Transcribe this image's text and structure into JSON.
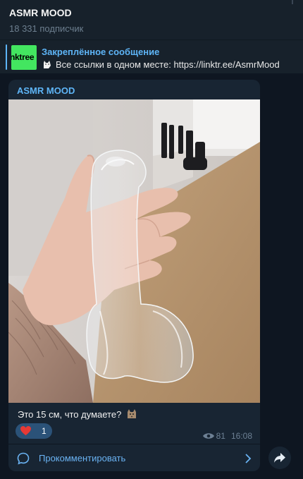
{
  "channel": {
    "title": "ASMR MOOD",
    "subscribers": "18 331 подписчик"
  },
  "pinned": {
    "heading": "Закреплённое сообщение",
    "thumb_text": "nktree",
    "text": "Все ссылки в одном месте: https://linktr.ee/AsmrMood",
    "emoji_icon": "cat-icon"
  },
  "message": {
    "author": "ASMR MOOD",
    "caption": "Это 15 см, что думаете?",
    "caption_emoji_icon": "cat-face-icon",
    "reaction": {
      "icon": "heart-icon",
      "count": "1"
    },
    "views": "81",
    "time": "16:08",
    "comment_label": "Прокомментировать"
  },
  "colors": {
    "background": "#0e1621",
    "panel": "#17212b",
    "bubble": "#182533",
    "accent": "#5eb5f7",
    "link": "#6ab3f3",
    "reaction_bg": "#2b5278",
    "heart": "#e53935",
    "linktree_green": "#43e660"
  }
}
